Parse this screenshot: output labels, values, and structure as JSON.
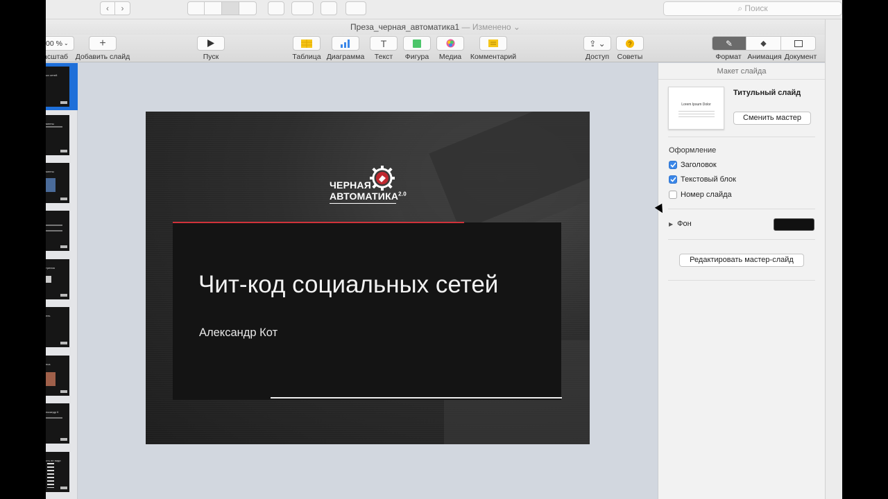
{
  "window": {
    "doc_name": "Преза_черная_автоматика1",
    "doc_status": "— Изменено"
  },
  "finder": {
    "search_placeholder": "Поиск"
  },
  "toolbar": {
    "zoom_value": "00 %",
    "zoom_label": "асштаб",
    "add_slide_label": "Добавить слайд",
    "play_label": "Пуск",
    "table_label": "Таблица",
    "chart_label": "Диаграмма",
    "text_label": "Текст",
    "shape_label": "Фигура",
    "media_label": "Медиа",
    "comment_label": "Комментарий",
    "share_label": "Доступ",
    "tips_label": "Советы",
    "format_label": "Формат",
    "animate_label": "Анимация",
    "document_label": "Документ",
    "text_icon": "Т"
  },
  "slide": {
    "logo_line1": "ЧЕРНАЯ",
    "logo_line2": "АВТОМАТИКА",
    "logo_version": "2.0",
    "title": "Чит-код социальных сетей",
    "author": "Александр Кот"
  },
  "navigator": {
    "thumbs": [
      {
        "label": "ых сетей"
      },
      {
        "label": "менты"
      },
      {
        "label": "менты"
      },
      {
        "label": ""
      },
      {
        "label": "трения"
      },
      {
        "label": "ень"
      },
      {
        "label": "нса"
      },
      {
        "label": "ександр К"
      },
      {
        "label": "сть не види"
      }
    ]
  },
  "inspector": {
    "header": "Макет слайда",
    "master_name": "Титульный слайд",
    "master_preview_text": "Lorem Ipsum Dolor",
    "change_master_button": "Сменить мастер",
    "appearance_label": "Оформление",
    "checkbox_title": "Заголовок",
    "checkbox_body": "Текстовый блок",
    "checkbox_slide_number": "Номер слайда",
    "background_label": "Фон",
    "edit_master_button": "Редактировать мастер-слайд",
    "title_checked": true,
    "body_checked": true,
    "slide_number_checked": false,
    "background_color": "#111111"
  },
  "colors": {
    "accent_blue": "#3b87e8",
    "slide_red_line": "#d0323a"
  }
}
